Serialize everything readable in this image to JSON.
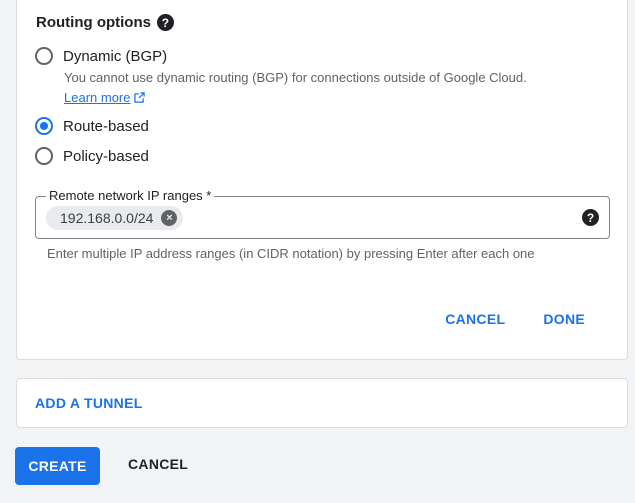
{
  "routing": {
    "title": "Routing options",
    "options": [
      {
        "label": "Dynamic (BGP)",
        "checked": false
      },
      {
        "label": "Route-based",
        "checked": true
      },
      {
        "label": "Policy-based",
        "checked": false
      }
    ],
    "dynamic_desc": "You cannot use dynamic routing (BGP) for connections outside of Google Cloud.",
    "learn_more": "Learn more"
  },
  "remote_ranges": {
    "label": "Remote network IP ranges *",
    "chips": [
      "192.168.0.0/24"
    ],
    "hint": "Enter multiple IP address ranges (in CIDR notation) by pressing Enter after each one"
  },
  "card_actions": {
    "cancel": "CANCEL",
    "done": "DONE"
  },
  "add_tunnel": "ADD A TUNNEL",
  "footer": {
    "create": "CREATE",
    "cancel": "CANCEL"
  },
  "colors": {
    "accent": "#1a73e8",
    "text": "#202124",
    "secondary_text": "#5f6368"
  }
}
